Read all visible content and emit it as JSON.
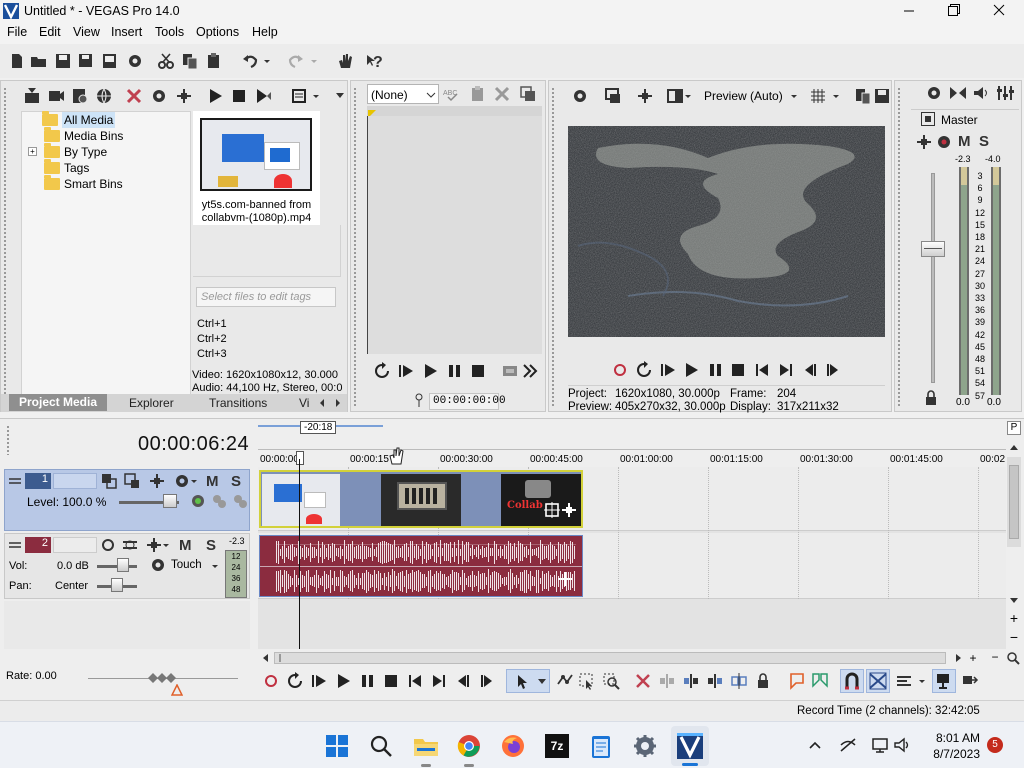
{
  "window": {
    "title": "Untitled * - VEGAS Pro 14.0"
  },
  "menu": {
    "items": [
      "File",
      "Edit",
      "View",
      "Insert",
      "Tools",
      "Options",
      "Help"
    ]
  },
  "project_media": {
    "tree": [
      "All Media",
      "Media Bins",
      "By Type",
      "Tags",
      "Smart Bins"
    ],
    "expand_symbol": "+",
    "file_label_line1": "yt5s.com-banned from",
    "file_label_line2": "collabvm-(1080p).mp4",
    "tags_placeholder": "Select files to edit tags",
    "shortcuts": [
      "Ctrl+1",
      "Ctrl+2",
      "Ctrl+3"
    ],
    "info_video": "Video: 1620x1080x12, 30.000",
    "info_audio": "Audio: 44,100 Hz, Stereo, 00:0",
    "tabs": [
      "Project Media",
      "Explorer",
      "Transitions",
      "Vi"
    ]
  },
  "trimmer": {
    "dropdown_value": "(None)",
    "timecode": "00:00:00:00"
  },
  "preview": {
    "mode": "Preview (Auto)",
    "project_label": "Project:",
    "project_value": "1620x1080, 30.000p",
    "preview_label": "Preview:",
    "preview_value": "405x270x32, 30.000p",
    "frame_label": "Frame:",
    "frame_value": "204",
    "display_label": "Display:",
    "display_value": "317x211x32"
  },
  "master": {
    "label": "Master",
    "peak_left": "-2.3",
    "peak_right": "-4.0",
    "scale": [
      "3",
      "6",
      "9",
      "12",
      "15",
      "18",
      "21",
      "24",
      "27",
      "30",
      "33",
      "36",
      "39",
      "42",
      "45",
      "48",
      "51",
      "54",
      "57"
    ],
    "val_left": "0.0",
    "val_right": "0.0",
    "m": "M",
    "s": "S"
  },
  "timeline": {
    "timecode": "00:00:06:24",
    "cursor_tag": "-20:18",
    "ruler": [
      "00:00:00",
      "00:00:15",
      "00:00:30:00",
      "00:00:45:00",
      "00:01:00:00",
      "00:01:15:00",
      "00:01:30:00",
      "00:01:45:00",
      "00:02"
    ],
    "video_track": {
      "number": "1",
      "level": "Level: 100.0 %",
      "m": "M",
      "s": "S"
    },
    "audio_track": {
      "number": "2",
      "vol_label": "Vol:",
      "vol_value": "0.0 dB",
      "pan_label": "Pan:",
      "pan_value": "Center",
      "automation": "Touch",
      "m": "M",
      "s": "S",
      "peak": "-2.3",
      "meter_scale": [
        "12",
        "24",
        "36",
        "48"
      ]
    },
    "rate": "Rate: 0.00"
  },
  "status": {
    "record_time": "Record Time (2 channels): 32:42:05"
  },
  "taskbar": {
    "time": "8:01 AM",
    "date": "8/7/2023",
    "notif": "5",
    "app_7z": "7z"
  },
  "colors": {
    "video_track": "#b8c8e6",
    "audio_clip": "#8b2c3f",
    "selection": "#cddbf0",
    "accent": "#0078d4"
  }
}
